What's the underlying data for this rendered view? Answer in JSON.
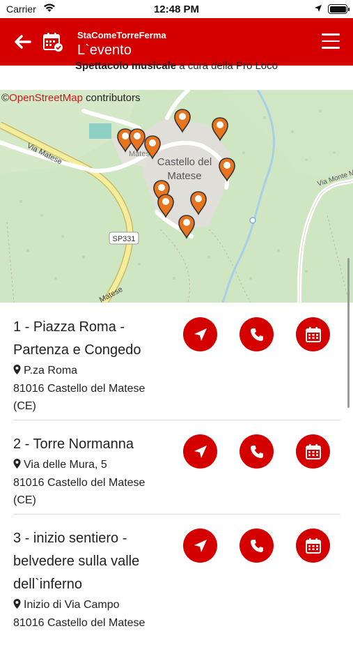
{
  "status_bar": {
    "carrier": "Carrier",
    "time": "12:48 PM"
  },
  "header": {
    "subtitle": "StaComeTorreFerma",
    "title": "L`evento"
  },
  "intro": {
    "bold": "Spettacolo musicale",
    "rest": " a cura della Pro Loco"
  },
  "map": {
    "attribution_symbol": "©",
    "attribution_link": "OpenStreetMap",
    "attribution_text": " contributors",
    "labels": {
      "town": "Castello del",
      "town2": "Matese",
      "road1": "Via Matese",
      "road2": "SP331",
      "road3": "Via Monte Mu",
      "road4": "Matese",
      "small": "Matese"
    },
    "marker_color": "#e8741e",
    "marker_count": 10
  },
  "stops": [
    {
      "name": "1 - Piazza Roma - Partenza e Congedo",
      "street": "P.za Roma",
      "city": "81016 Castello del Matese (CE)"
    },
    {
      "name": "2 - Torre Normanna",
      "street": "Via delle Mura, 5",
      "city": "81016 Castello del Matese (CE)"
    },
    {
      "name": "3 - inizio sentiero - belvedere sulla valle dell`inferno",
      "street": "Inizio di Via Campo",
      "city": "81016 Castello del Matese"
    }
  ],
  "colors": {
    "brand": "#d40000",
    "marker": "#e8741e"
  }
}
